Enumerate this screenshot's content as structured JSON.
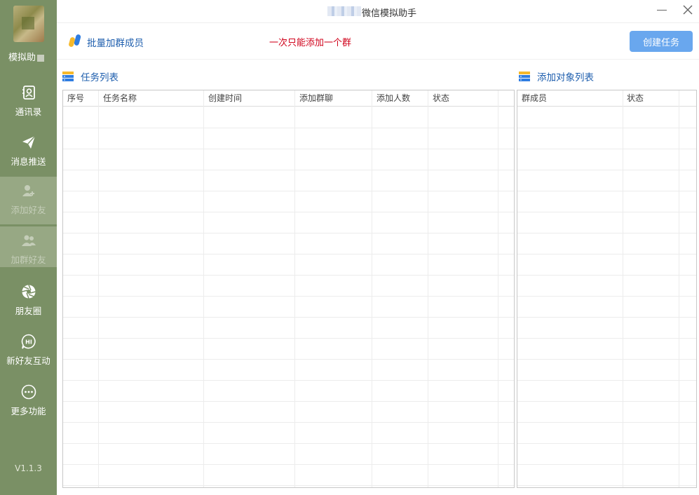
{
  "sidebar": {
    "app_name": "模拟助",
    "items": [
      {
        "label": "通讯录",
        "icon": "contacts-icon",
        "disabled": false
      },
      {
        "label": "消息推送",
        "icon": "paper-plane-icon",
        "disabled": false
      },
      {
        "label": "添加好友",
        "icon": "add-user-icon",
        "disabled": true
      },
      {
        "label": "加群好友",
        "icon": "group-icon",
        "disabled": true
      },
      {
        "label": "朋友圈",
        "icon": "aperture-icon",
        "disabled": false
      },
      {
        "label": "新好友互动",
        "icon": "hi-chat-icon",
        "disabled": false
      },
      {
        "label": "更多功能",
        "icon": "more-icon",
        "disabled": false
      }
    ],
    "version": "V1.1.3"
  },
  "window": {
    "title": "微信模拟助手"
  },
  "header": {
    "section_title": "批量加群成员",
    "notice": "一次只能添加一个群",
    "create_button": "创建任务"
  },
  "task_panel": {
    "title": "任务列表",
    "columns": [
      "序号",
      "任务名称",
      "创建时间",
      "添加群聊",
      "添加人数",
      "状态"
    ],
    "rows": []
  },
  "target_panel": {
    "title": "添加对象列表",
    "columns": [
      "群成员",
      "状态"
    ],
    "rows": []
  },
  "colors": {
    "sidebar_bg": "#7a9065",
    "accent_blue": "#1f5fae",
    "button_blue": "#69a7ee",
    "notice_red": "#d0021b"
  }
}
